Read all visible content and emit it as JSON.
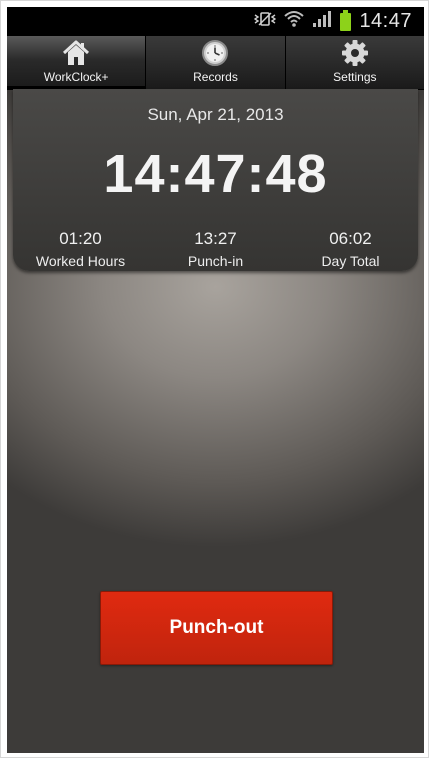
{
  "status_bar": {
    "time": "14:47",
    "icons": [
      "vibrate-icon",
      "wifi-icon",
      "signal-icon",
      "battery-icon"
    ],
    "battery_color": "#8dd21a"
  },
  "tabs": [
    {
      "label": "WorkClock+",
      "icon": "home-icon",
      "active": true
    },
    {
      "label": "Records",
      "icon": "clock-icon",
      "active": false
    },
    {
      "label": "Settings",
      "icon": "gear-icon",
      "active": false
    }
  ],
  "clock": {
    "date": "Sun, Apr 21, 2013",
    "time": "14:47:48",
    "stats": [
      {
        "value": "01:20",
        "label": "Worked Hours"
      },
      {
        "value": "13:27",
        "label": "Punch-in"
      },
      {
        "value": "06:02",
        "label": "Day Total"
      }
    ]
  },
  "punch_button": {
    "label": "Punch-out",
    "color": "#d52812"
  }
}
